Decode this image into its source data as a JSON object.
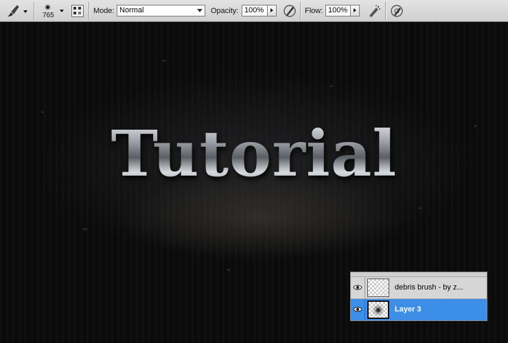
{
  "options_bar": {
    "brush_size": "765",
    "mode_label": "Mode:",
    "mode_value": "Normal",
    "opacity_label": "Opacity:",
    "opacity_value": "100%",
    "flow_label": "Flow:",
    "flow_value": "100%"
  },
  "canvas": {
    "headline_text": "Tutorial"
  },
  "layers_panel": {
    "layers": [
      {
        "name": "debris brush - by z...",
        "visible": true,
        "selected": false
      },
      {
        "name": "Layer 3",
        "visible": true,
        "selected": true
      }
    ]
  },
  "colors": {
    "selection_blue": "#3d8ee6",
    "toolbar_gray": "#d9d9d9",
    "canvas_dark": "#0b0b0c"
  }
}
